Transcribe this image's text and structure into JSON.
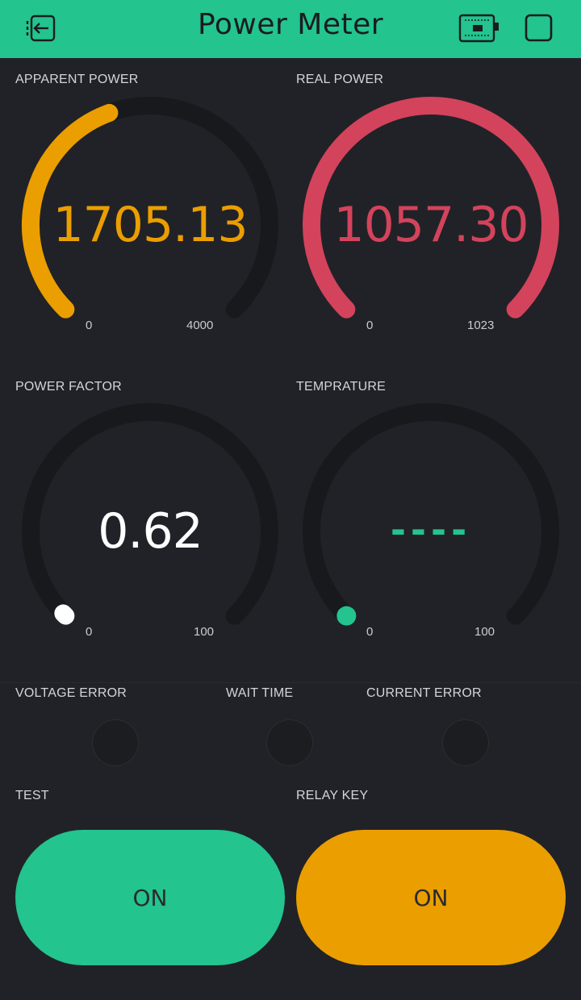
{
  "header": {
    "title": "Power Meter",
    "accent": "#23c48e",
    "left_icon": "exit-icon",
    "right_icons": [
      "device-board-icon",
      "square-icon"
    ]
  },
  "gauges": [
    {
      "label": "APPARENT POWER",
      "value": "1705.13",
      "min": "0",
      "max": "4000",
      "color": "#eb9e00",
      "fraction": 0.426
    },
    {
      "label": "REAL POWER",
      "value": "1057.30",
      "min": "0",
      "max": "1023",
      "color": "#d3435c",
      "fraction": 1.0
    },
    {
      "label": "POWER FACTOR",
      "value": "0.62",
      "min": "0",
      "max": "100",
      "color": "#ffffff",
      "fraction": 0.0062
    },
    {
      "label": "TEMPRATURE",
      "value": "----",
      "min": "0",
      "max": "100",
      "color": "#23c48e",
      "fraction": 0
    }
  ],
  "leds": [
    {
      "label": "VOLTAGE ERROR"
    },
    {
      "label": "WAIT TIME"
    },
    {
      "label": "CURRENT ERROR"
    }
  ],
  "buttons": [
    {
      "label": "TEST",
      "state": "ON",
      "color": "#23c48e"
    },
    {
      "label": "RELAY KEY",
      "state": "ON",
      "color": "#eb9e00"
    }
  ]
}
